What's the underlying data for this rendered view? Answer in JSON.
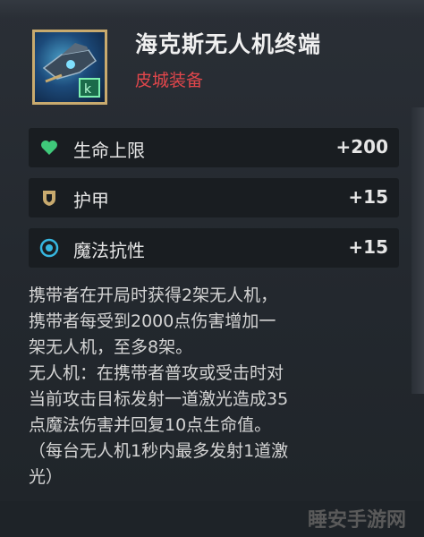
{
  "item": {
    "name": "海克斯无人机终端",
    "category": "皮城装备",
    "icon": "drone-terminal-icon"
  },
  "stats": [
    {
      "icon": "heart-icon",
      "color": "#3fc97a",
      "label": "生命上限",
      "value": "+200"
    },
    {
      "icon": "armor-shield-icon",
      "color": "#c8aa6e",
      "label": "护甲",
      "value": "+15"
    },
    {
      "icon": "magic-resist-icon",
      "color": "#36b7e0",
      "label": "魔法抗性",
      "value": "+15"
    }
  ],
  "description": [
    "携带者在开局时获得2架无人机，",
    "携带者每受到2000点伤害增加一",
    "架无人机，至多8架。",
    "无人机：在携带者普攻或受击时对",
    "当前攻击目标发射一道激光造成35",
    "点魔法伤害并回复10点生命值。",
    "（每台无人机1秒内最多发射1道激",
    "光）"
  ],
  "watermark": "睡安手游网"
}
